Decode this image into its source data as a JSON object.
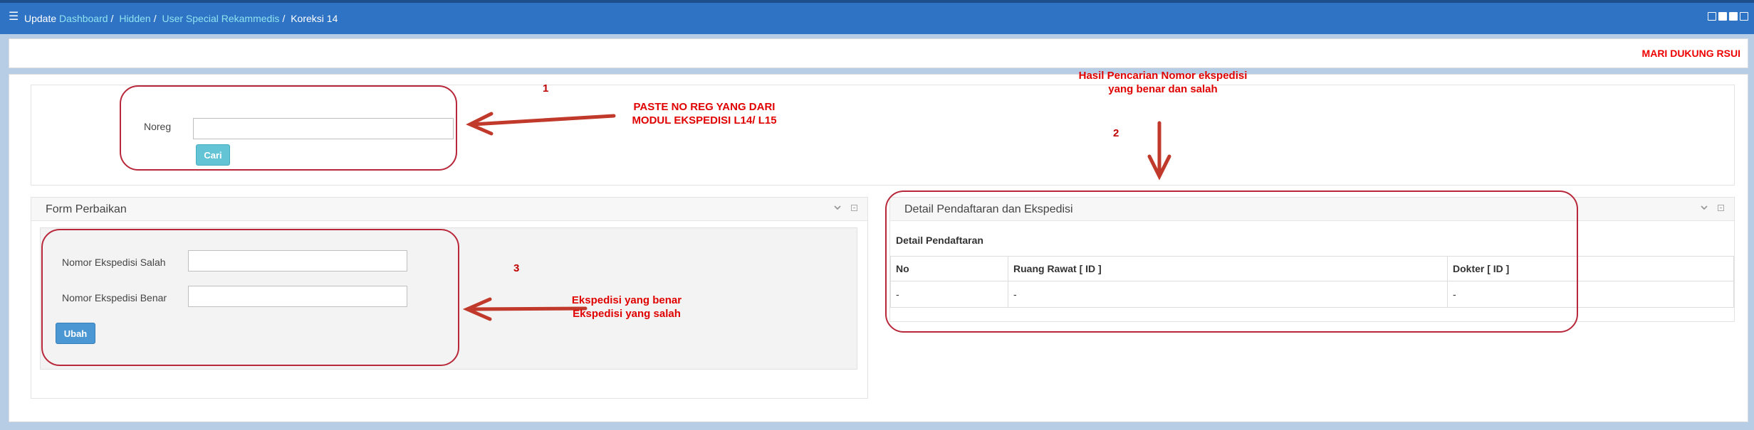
{
  "header": {
    "prefix": "Update",
    "breadcrumb": [
      "Dashboard",
      "Hidden",
      "User Special Rekammedis",
      "Koreksi 14"
    ],
    "icons": [
      "image-icon",
      "clipboard-icon",
      "chat-icon",
      "calendar-icon"
    ]
  },
  "marquee": {
    "text": "MARI DUKUNG RSUI"
  },
  "search": {
    "label": "Noreg",
    "value": "",
    "placeholder": "",
    "button_label": "Cari"
  },
  "form_perbaikan": {
    "title": "Form Perbaikan",
    "fields": [
      {
        "label": "Nomor Ekspedisi Salah",
        "value": ""
      },
      {
        "label": "Nomor Ekspedisi Benar",
        "value": ""
      }
    ],
    "button_label": "Ubah"
  },
  "detail": {
    "title": "Detail Pendaftaran dan Ekspedisi",
    "section_title": "Detail Pendaftaran",
    "columns": [
      "No",
      "Ruang Rawat [ ID ]",
      "Dokter [ ID ]"
    ],
    "rows": [
      [
        "-",
        "-",
        "-"
      ]
    ]
  },
  "annotations": {
    "num1": "1",
    "num2": "2",
    "num3": "3",
    "note1": [
      "PASTE NO REG YANG DARI",
      "MODUL EKSPEDISI L14/ L15"
    ],
    "note2": [
      "Hasil Pencarian Nomor ekspedisi",
      "yang benar dan salah"
    ],
    "note3": [
      "Ekspedisi yang benar",
      "Ekspedisi yang salah"
    ]
  },
  "colors": {
    "topbar": "#2f73c5",
    "breadcrumb_link": "#8fe3ef",
    "annotation_red": "#e00000",
    "highlight_border": "#b8283a",
    "button_cari": "#62c4d5",
    "button_ubah": "#4a97d3"
  }
}
